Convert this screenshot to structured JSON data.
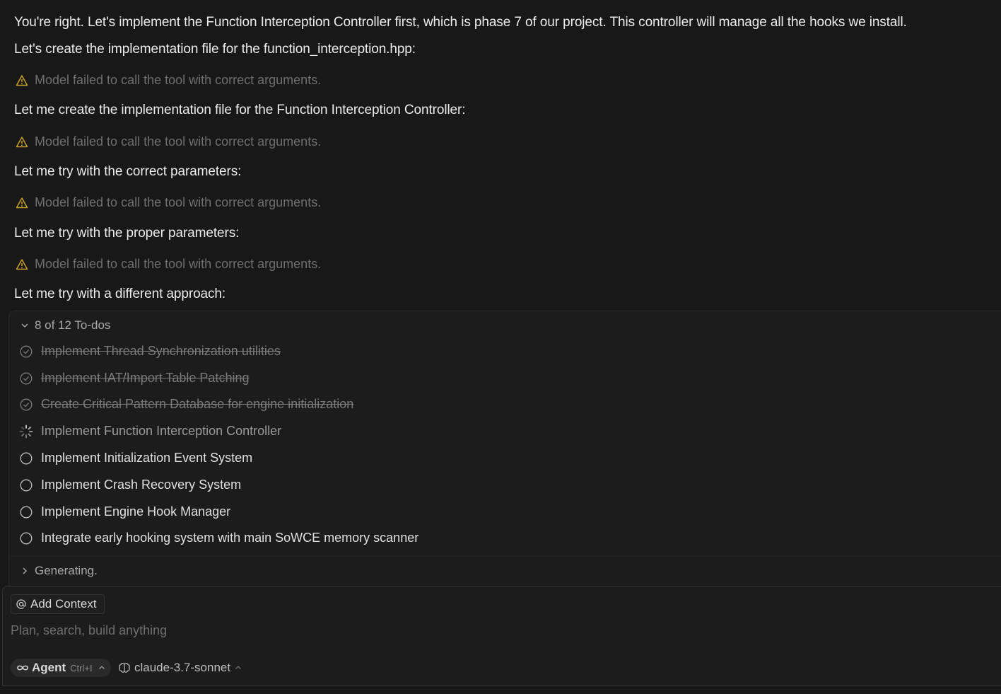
{
  "messages": [
    "You're right. Let's implement the Function Interception Controller first, which is phase 7 of our project. This controller will manage all the hooks we install.",
    "Let's create the implementation file for the function_interception.hpp:",
    "Let me create the implementation file for the Function Interception Controller:",
    "Let me try with the correct parameters:",
    "Let me try with the proper parameters:",
    "Let me try with a different approach:"
  ],
  "warnings": [
    "Model failed to call the tool with correct arguments.",
    "Model failed to call the tool with correct arguments.",
    "Model failed to call the tool with correct arguments.",
    "Model failed to call the tool with correct arguments."
  ],
  "colors": {
    "background": "#181818",
    "warning_icon": "#c9a227",
    "muted_text": "#6f6f6f"
  },
  "todos": {
    "header": "8 of 12 To-dos",
    "items": [
      {
        "label": "Implement Thread Synchronization utilities",
        "status": "completed"
      },
      {
        "label": "Implement IAT/Import Table Patching",
        "status": "completed"
      },
      {
        "label": "Create Critical Pattern Database for engine initialization",
        "status": "completed"
      },
      {
        "label": "Implement Function Interception Controller",
        "status": "in-progress"
      },
      {
        "label": "Implement Initialization Event System",
        "status": "pending"
      },
      {
        "label": "Implement Crash Recovery System",
        "status": "pending"
      },
      {
        "label": "Implement Engine Hook Manager",
        "status": "pending"
      },
      {
        "label": "Integrate early hooking system with main SoWCE memory scanner",
        "status": "pending"
      }
    ]
  },
  "generating": "Generating.",
  "composer": {
    "add_context": "Add Context",
    "placeholder": "Plan, search, build anything",
    "mode_label": "Agent",
    "mode_shortcut": "Ctrl+I",
    "model": "claude-3.7-sonnet"
  }
}
